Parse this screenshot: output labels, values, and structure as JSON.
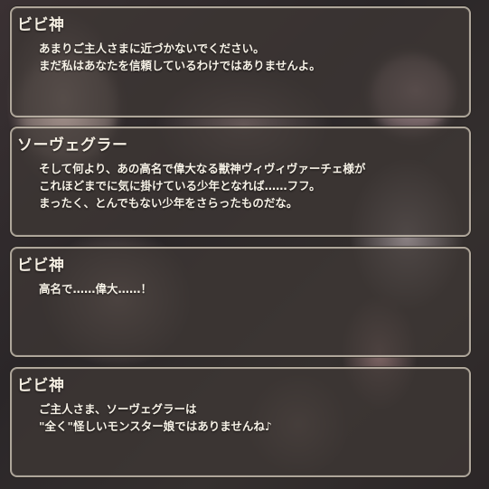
{
  "dialogs": [
    {
      "speaker": "ビビ神",
      "lines": [
        "あまりご主人さまに近づかないでください。",
        "まだ私はあなたを信頼しているわけではありませんよ。"
      ]
    },
    {
      "speaker": "ソーヴェグラー",
      "lines": [
        "そして何より、あの高名で偉大なる獣神ヴィヴィヴァーチェ様が",
        "これほどまでに気に掛けている少年となれば……フフ。",
        "まったく、とんでもない少年をさらったものだな。"
      ]
    },
    {
      "speaker": "ビビ神",
      "lines": [
        "高名で……偉大……！"
      ]
    },
    {
      "speaker": "ビビ神",
      "lines": [
        "ご主人さま、ソーヴェグラーは",
        "\"全く\"怪しいモンスター娘ではありませんね♪"
      ]
    }
  ]
}
